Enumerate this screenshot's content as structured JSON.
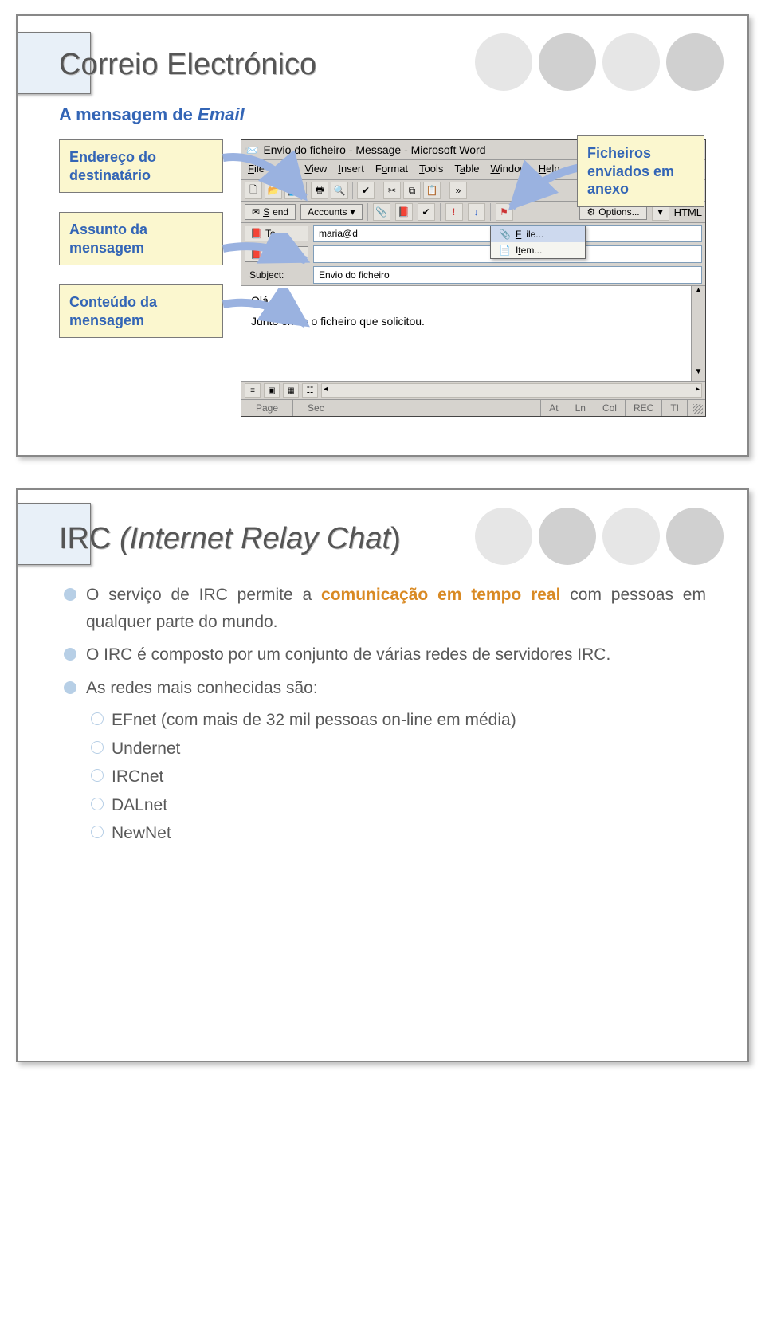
{
  "slide1": {
    "thumb_alt": "Email client thumbnail",
    "title": "Correio Electrónico",
    "subtitle_prefix": "A mensagem de ",
    "subtitle_em": "Email",
    "callouts": {
      "to": "Endereço do destinatário",
      "subject": "Assunto da mensagem",
      "body": "Conteúdo da mensagem",
      "attach": "Ficheiros enviados em anexo"
    },
    "word": {
      "title": "Envio do ficheiro - Message - Microsoft Word",
      "menu": {
        "file": "File",
        "edit": "Edit",
        "view": "View",
        "insert": "Insert",
        "format": "Format",
        "tools": "Tools",
        "table": "Table",
        "window": "Window",
        "help": "Help"
      },
      "font": "Arial",
      "send": "Send",
      "accounts": "Accounts",
      "options": "Options...",
      "format_sel": "HTML",
      "to_label": "To...",
      "to_value": "maria@d",
      "cc_label": "Cc...",
      "cc_value": "",
      "subject_label": "Subject:",
      "subject_value": "Envio do ficheiro",
      "attach_menu": {
        "file": "File...",
        "item": "Item..."
      },
      "body_line1": "Olá,",
      "body_line2": "Junto envio o ficheiro que solicitou.",
      "status": {
        "page": "Page",
        "sec": "Sec",
        "at": "At",
        "ln": "Ln",
        "col": "Col",
        "rec": "REC",
        "trk": "TI"
      }
    }
  },
  "slide2": {
    "thumb_alt": "IRC client thumbnail",
    "title_normal": "IRC ",
    "title_italic1": "(Internet Relay Chat",
    "title_italic_close": ")",
    "bullets": [
      {
        "pre": "O serviço de IRC permite a ",
        "hi": "comunicação em tempo real",
        "post": " com pessoas em qualquer parte do mundo."
      },
      {
        "pre": "O IRC é composto por um conjunto de várias redes de servidores IRC.",
        "hi": "",
        "post": ""
      },
      {
        "pre": "As redes mais conhecidas são:",
        "hi": "",
        "post": "",
        "sub": [
          "EFnet (com mais de 32 mil pessoas on-line em média)",
          "Undernet",
          "IRCnet",
          "DALnet",
          "NewNet"
        ]
      }
    ]
  }
}
